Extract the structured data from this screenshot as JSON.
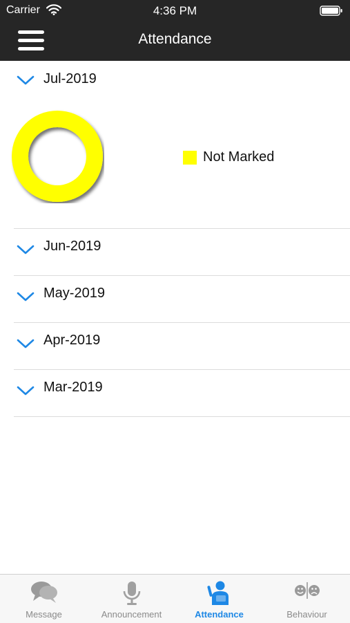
{
  "status_bar": {
    "carrier": "Carrier",
    "time": "4:36 PM",
    "wifi_icon": "wifi-icon",
    "battery_icon": "battery-icon"
  },
  "header": {
    "title": "Attendance",
    "menu_icon": "hamburger-menu-icon",
    "background": "#262626"
  },
  "months": [
    {
      "label": "Jul-2019",
      "expanded": true
    },
    {
      "label": "Jun-2019",
      "expanded": false
    },
    {
      "label": "May-2019",
      "expanded": false
    },
    {
      "label": "Apr-2019",
      "expanded": false
    },
    {
      "label": "Mar-2019",
      "expanded": false
    }
  ],
  "chart_data": {
    "type": "pie",
    "donut": true,
    "categories": [
      "Not Marked"
    ],
    "values": [
      100
    ],
    "colors": [
      "#ffff00"
    ],
    "legend_position": "right"
  },
  "tab_bar": {
    "tabs": [
      {
        "label": "Message",
        "icon": "chat-bubbles-icon",
        "active": false
      },
      {
        "label": "Announcement",
        "icon": "microphone-icon",
        "active": false
      },
      {
        "label": "Attendance",
        "icon": "attendance-person-icon",
        "active": true
      },
      {
        "label": "Behaviour",
        "icon": "behaviour-faces-icon",
        "active": false
      }
    ]
  },
  "colors": {
    "accent": "#1e88e5",
    "chevron": "#1e88e5",
    "inactive_tab": "#8a8a8a"
  }
}
